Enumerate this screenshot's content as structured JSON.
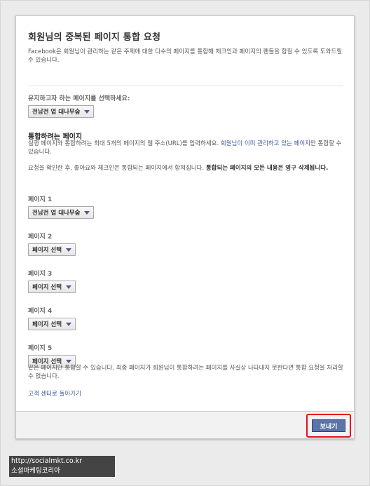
{
  "dialog": {
    "title": "회원님의 중복된 페이지 통합 요청",
    "intro": "Facebook은 회원님이 관리하는 같은 주제에 대한 다수의 페이지를 통합해 체크인과 페이지의 팬들을 합칠 수 있도록 도와드릴 수 있습니다.",
    "keep_label": "유지하고자 하는 페이지를 선택하세요:",
    "keep_select_value": "전남전 엽 대나무숲",
    "merge_heading": "통합하려는 페이지",
    "merge_desc_part1": "실행 페이지와 통합하려는 최대 5개의 페이지의 웹 주소(URL)를 입력하세요. ",
    "merge_desc_link": "회원님이 이미 관리하고 있는 페이지",
    "merge_desc_part2": "만 통합할 수 있습니다.",
    "review_note_part1": "요청을 확인한 후, 좋아요와 체크인은 통합되는 페이지에서 합쳐집니다. ",
    "review_note_bold": "통합되는 페이지의 모든 내용은 영구 삭제됩니다.",
    "pages": [
      {
        "label": "페이지 1",
        "value": "전남전 엽 대나무숲"
      },
      {
        "label": "페이지 2",
        "value": "페이지 선택"
      },
      {
        "label": "페이지 3",
        "value": "페이지 선택"
      },
      {
        "label": "페이지 4",
        "value": "페이지 선택"
      },
      {
        "label": "페이지 5",
        "value": "페이지 선택"
      }
    ],
    "footer_note": "같은 페이지만 통합할 수 있습니다. 최종 페이지가 회원님이 통합하려는 페이지를 사실상 나타내지 못한다면 통합 요청을 처리할 수 없습니다.",
    "help_link": "고객 센터로 돌아가기",
    "send_label": "보내기"
  },
  "watermark": {
    "url": "http://socialmkt.co.kr",
    "name": "소셜마케팅코리아"
  },
  "colors": {
    "link": "#3b5998",
    "button": "#5b74a8",
    "highlight": "#e0141e"
  }
}
